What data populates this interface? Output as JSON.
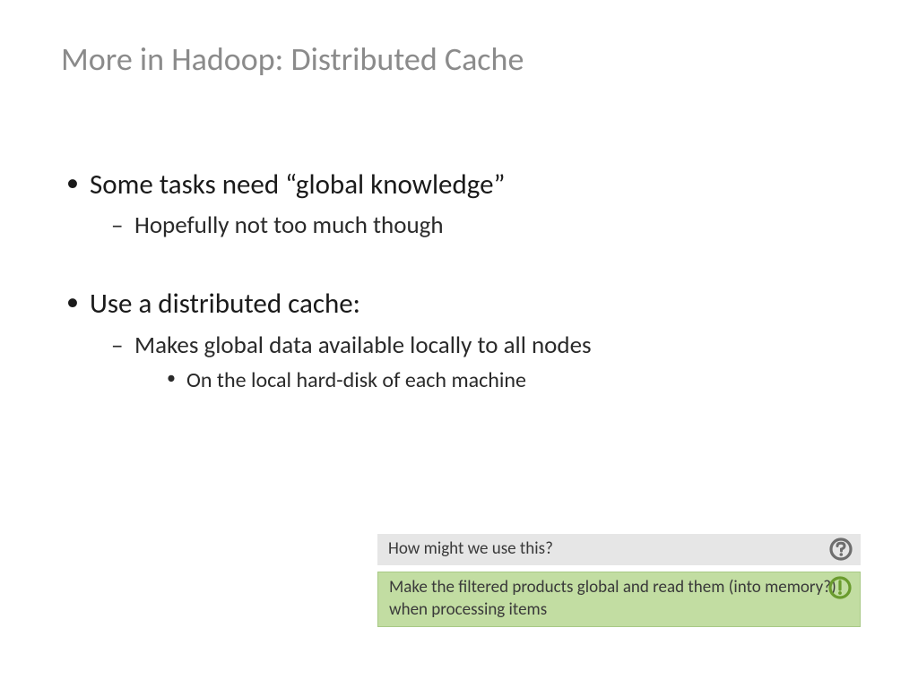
{
  "title": "More in Hadoop: Distributed Cache",
  "bullets": {
    "b1": "Some tasks need “global knowledge”",
    "b1_1": "Hopefully not too much though",
    "b2": "Use a distributed cache:",
    "b2_1": "Makes global data available locally to all nodes",
    "b2_1_1": "On the local hard-disk of each machine"
  },
  "callouts": {
    "question": "How might we use this?",
    "answer": "Make the filtered products global and read them (into memory?) when processing items"
  },
  "colors": {
    "title_gray": "#8b8b8b",
    "question_bg": "#e6e6e6",
    "answer_bg": "#c2dda2",
    "icon_gray": "#6e6e6e",
    "icon_green": "#6a9b2e"
  }
}
